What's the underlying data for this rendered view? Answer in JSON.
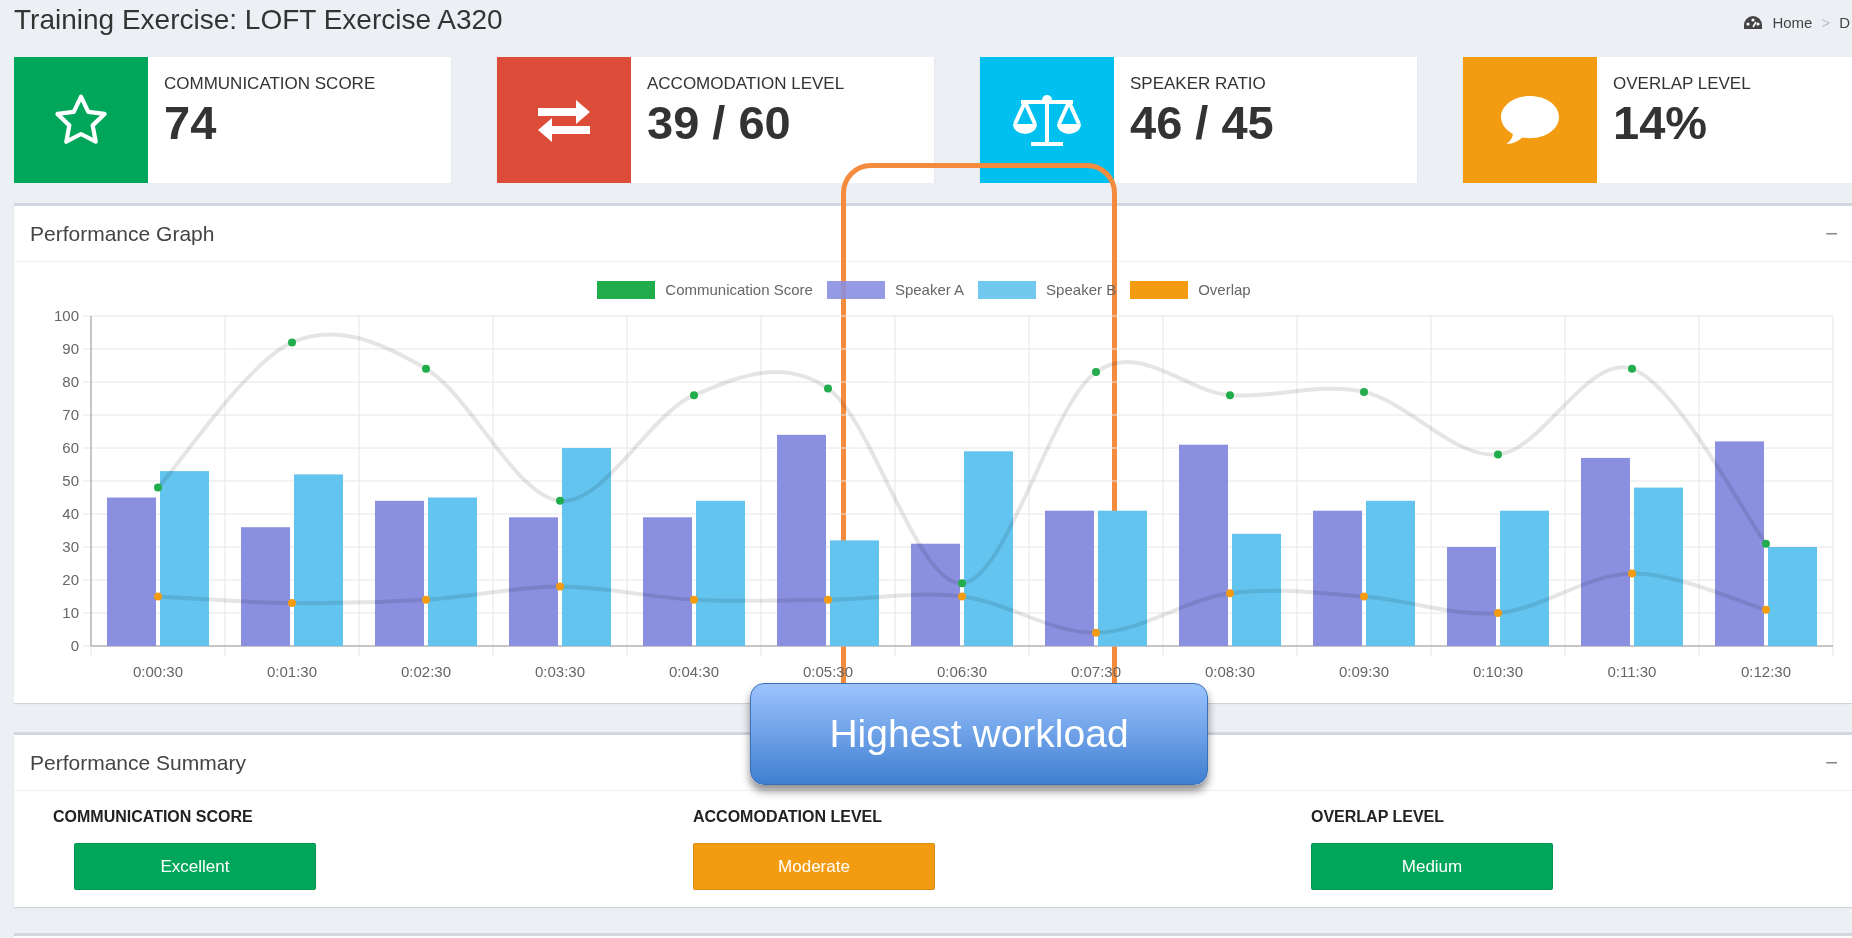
{
  "page": {
    "title": "Training Exercise: LOFT Exercise A320"
  },
  "breadcrumb": {
    "separator": ">",
    "items": [
      {
        "label": "Home"
      },
      {
        "label": "D"
      }
    ]
  },
  "stats": [
    {
      "kind": "star",
      "label": "COMMUNICATION SCORE",
      "value": "74",
      "color": "#00a65a"
    },
    {
      "kind": "exchange",
      "label": "ACCOMODATION LEVEL",
      "value": "39 / 60",
      "color": "#dd4b39"
    },
    {
      "kind": "scale",
      "label": "SPEAKER RATIO",
      "value": "46 / 45",
      "color": "#00c0ef"
    },
    {
      "kind": "chat",
      "label": "OVERLAP LEVEL",
      "value": "14%",
      "color": "#f39c12"
    }
  ],
  "graph_panel": {
    "title": "Performance Graph",
    "collapse": "−",
    "chart_data": {
      "type": "bar",
      "grid": true,
      "categories": [
        "0:00:30",
        "0:01:30",
        "0:02:30",
        "0:03:30",
        "0:04:30",
        "0:05:30",
        "0:06:30",
        "0:07:30",
        "0:08:30",
        "0:09:30",
        "0:10:30",
        "0:11:30",
        "0:12:30"
      ],
      "ylim": [
        0,
        100
      ],
      "yticks": [
        0,
        10,
        20,
        30,
        40,
        50,
        60,
        70,
        80,
        90,
        100
      ],
      "series": [
        {
          "name": "Communication Score",
          "type": "line",
          "marker": true,
          "color": "#22ad4c",
          "values": [
            48,
            92,
            84,
            44,
            76,
            78,
            19,
            83,
            76,
            77,
            58,
            84,
            31
          ]
        },
        {
          "name": "Speaker A",
          "type": "bar",
          "color": "#8b8fe0",
          "values": [
            45,
            36,
            44,
            39,
            39,
            64,
            31,
            41,
            61,
            41,
            30,
            57,
            62
          ]
        },
        {
          "name": "Speaker B",
          "type": "bar",
          "color": "#62c4ef",
          "values": [
            53,
            52,
            45,
            60,
            44,
            32,
            59,
            41,
            34,
            44,
            41,
            48,
            30
          ]
        },
        {
          "name": "Overlap",
          "type": "line",
          "marker": true,
          "color": "#f39c12",
          "values": [
            15,
            13,
            14,
            18,
            14,
            14,
            15,
            4,
            16,
            15,
            10,
            22,
            11
          ]
        }
      ]
    }
  },
  "summary_panel": {
    "title": "Performance Summary",
    "collapse": "−",
    "items": [
      {
        "label": "COMMUNICATION SCORE",
        "rating": "Excellent",
        "color": "#00a65a"
      },
      {
        "label": "ACCOMODATION LEVEL",
        "rating": "Moderate",
        "color": "#f39c12"
      },
      {
        "label": "OVERLAP LEVEL",
        "rating": "Medium",
        "color": "#00a65a"
      }
    ]
  },
  "callout": {
    "text": "Highest workload"
  }
}
